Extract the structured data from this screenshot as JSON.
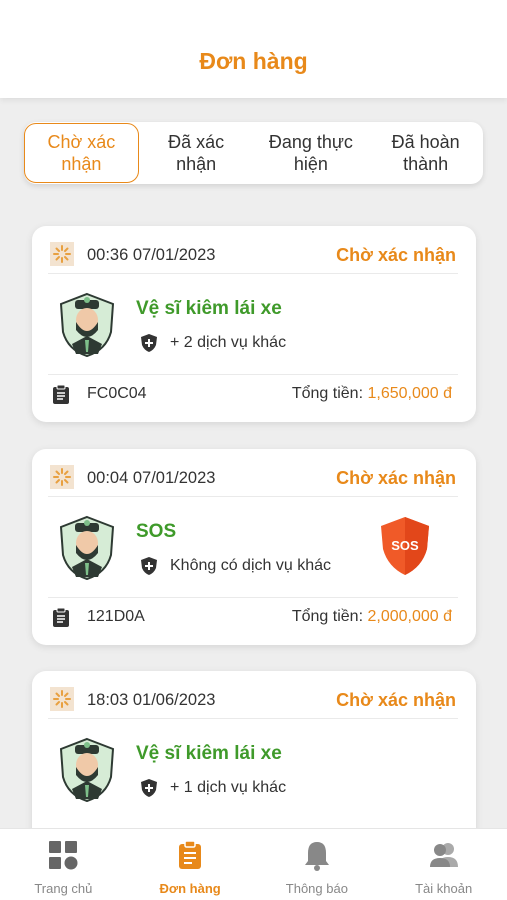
{
  "header": {
    "title": "Đơn hàng"
  },
  "tabs": [
    {
      "label": "Chờ xác\nnhận",
      "active": true
    },
    {
      "label": "Đã xác\nnhận",
      "active": false
    },
    {
      "label": "Đang thực\nhiện",
      "active": false
    },
    {
      "label": "Đã hoàn\nthành",
      "active": false
    }
  ],
  "orders": [
    {
      "time": "00:36 07/01/2023",
      "status": "Chờ xác nhận",
      "service": "Vệ sĩ kiêm lái xe",
      "extra": "+ 2 dịch vụ khác",
      "code": "FC0C04",
      "total_label": "Tổng tiền:",
      "total_amount": "1,650,000 đ",
      "sos": false
    },
    {
      "time": "00:04 07/01/2023",
      "status": "Chờ xác nhận",
      "service": "SOS",
      "extra": "Không có dịch vụ khác",
      "code": "121D0A",
      "total_label": "Tổng tiền:",
      "total_amount": "2,000,000 đ",
      "sos": true,
      "sos_label": "SOS"
    },
    {
      "time": "18:03 01/06/2023",
      "status": "Chờ xác nhận",
      "service": "Vệ sĩ kiêm lái xe",
      "extra": "+ 1 dịch vụ khác",
      "code": "",
      "total_label": "",
      "total_amount": "",
      "sos": false
    }
  ],
  "nav": [
    {
      "label": "Trang chủ",
      "icon": "grid-icon",
      "active": false
    },
    {
      "label": "Đơn hàng",
      "icon": "clipboard-icon",
      "active": true
    },
    {
      "label": "Thông báo",
      "icon": "bell-icon",
      "active": false
    },
    {
      "label": "Tài khoản",
      "icon": "users-icon",
      "active": false
    }
  ],
  "colors": {
    "accent": "#e8891a",
    "service_green": "#3f9a2a",
    "sos_red": "#f05a28"
  }
}
